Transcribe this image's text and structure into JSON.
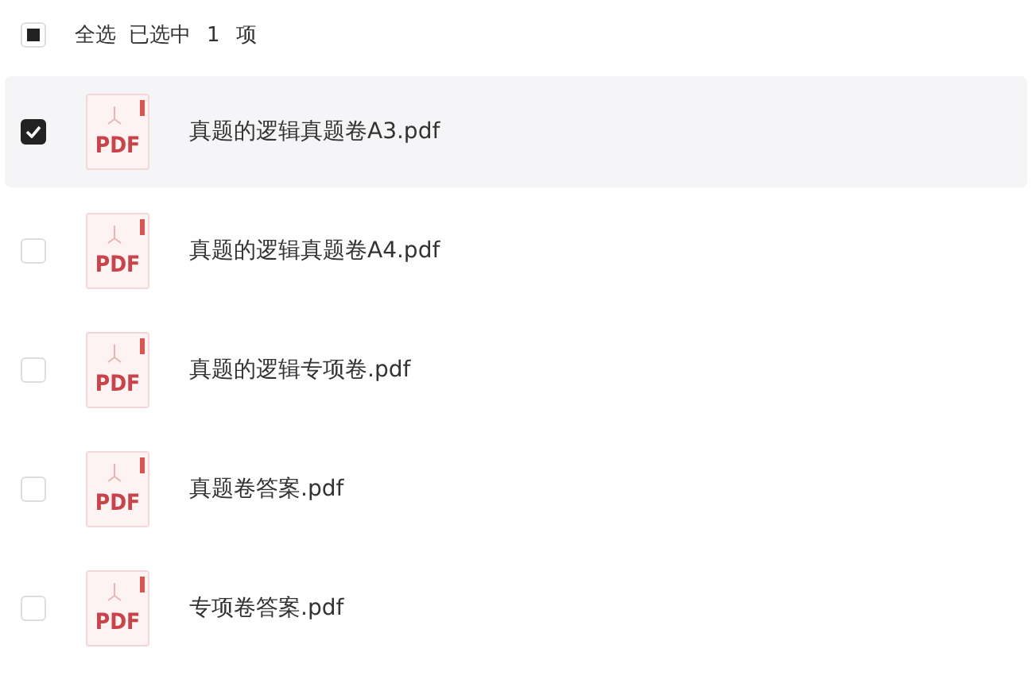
{
  "header": {
    "select_all": {
      "label": "全选",
      "indeterminate": true
    },
    "selected_label": "已选中",
    "selected_count": "1",
    "unit": "项"
  },
  "files": [
    {
      "name": "真题的逻辑真题卷A3.pdf",
      "icon_label": "PDF",
      "selected": true
    },
    {
      "name": "真题的逻辑真题卷A4.pdf",
      "icon_label": "PDF",
      "selected": false
    },
    {
      "name": "真题的逻辑专项卷.pdf",
      "icon_label": "PDF",
      "selected": false
    },
    {
      "name": "真题卷答案.pdf",
      "icon_label": "PDF",
      "selected": false
    },
    {
      "name": "专项卷答案.pdf",
      "icon_label": "PDF",
      "selected": false
    }
  ]
}
